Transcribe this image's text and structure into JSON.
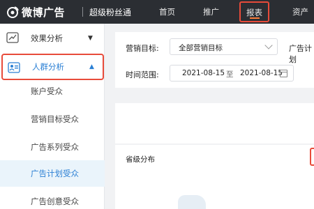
{
  "topbar": {
    "logo_text": "微博广告",
    "product": "超级粉丝通",
    "nav": [
      {
        "label": "首页"
      },
      {
        "label": "推广"
      },
      {
        "label": "报表"
      },
      {
        "label": "资产"
      }
    ]
  },
  "sidebar": {
    "groups": [
      {
        "label": "效果分析",
        "caret": "▼",
        "icon": "trend-chart-icon"
      },
      {
        "label": "人群分析",
        "caret": "▲",
        "icon": "audience-icon"
      }
    ],
    "sub_items": [
      {
        "label": "账户受众"
      },
      {
        "label": "营销目标受众"
      },
      {
        "label": "广告系列受众"
      },
      {
        "label": "广告计划受众"
      },
      {
        "label": "广告创意受众"
      }
    ]
  },
  "filters": {
    "marketing_label": "营销目标:",
    "marketing_value": "全部营销目标",
    "plan_label": "广告计划",
    "time_label": "时间范围:",
    "date_start": "2021-08-15",
    "date_sep": "至",
    "date_end": "2021-08-15"
  },
  "panels": {
    "province_title": "省级分布"
  },
  "colors": {
    "topbar": "#2b2e33",
    "highlight": "#e84b3a",
    "accent": "#2a7fd4",
    "selected_bg": "#eaf4fb"
  }
}
